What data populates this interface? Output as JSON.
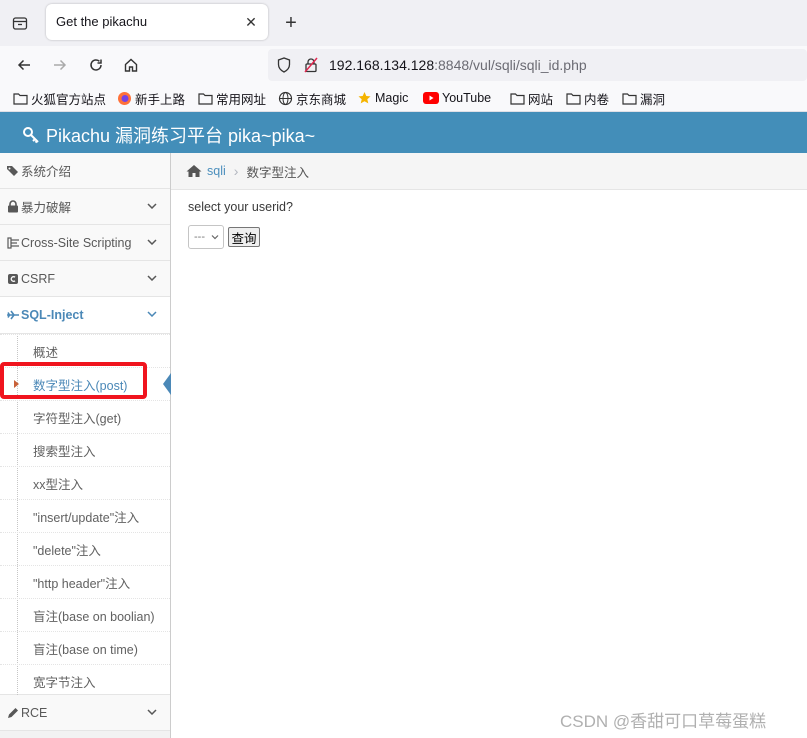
{
  "browser": {
    "tab_title": "Get the pikachu",
    "url_host": "192.168.134.128",
    "url_rest": ":8848/vul/sqli/sqli_id.php",
    "bookmarks": [
      "火狐官方站点",
      "新手上路",
      "常用网址",
      "京东商城",
      "Magic",
      "YouTube",
      "网站",
      "内卷",
      "漏洞"
    ]
  },
  "app": {
    "title": "Pikachu 漏洞练习平台 pika~pika~"
  },
  "sidebar": {
    "items": [
      {
        "label": "系统介绍"
      },
      {
        "label": "暴力破解"
      },
      {
        "label": "Cross-Site Scripting"
      },
      {
        "label": "CSRF"
      },
      {
        "label": "SQL-Inject"
      },
      {
        "label": "RCE"
      }
    ],
    "sub_items": [
      {
        "label": "概述"
      },
      {
        "label": "数字型注入(post)"
      },
      {
        "label": "字符型注入(get)"
      },
      {
        "label": "搜索型注入"
      },
      {
        "label": "xx型注入"
      },
      {
        "label": "\"insert/update\"注入"
      },
      {
        "label": "\"delete\"注入"
      },
      {
        "label": "\"http header\"注入"
      },
      {
        "label": "盲注(base on boolian)"
      },
      {
        "label": "盲注(base on time)"
      },
      {
        "label": "宽字节注入"
      }
    ]
  },
  "breadcrumbs": {
    "link": "sqli",
    "current": "数字型注入"
  },
  "main": {
    "question": "select your userid?",
    "select_value": "---",
    "query_button": "查询"
  },
  "watermark": "CSDN @香甜可口草莓蛋糕",
  "colors": {
    "header": "#438eb9",
    "active_link": "#4b88b7",
    "highlight": "#f0141e"
  }
}
